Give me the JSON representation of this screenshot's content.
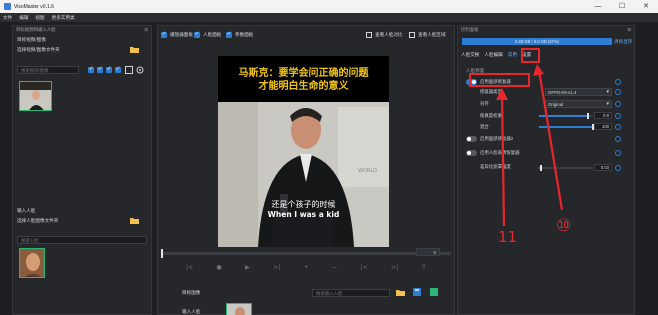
{
  "window": {
    "title": "VisoMaster v0.1.6",
    "controls": [
      "—",
      "☐",
      "✕"
    ]
  },
  "menu": [
    "文件",
    "编辑",
    "视图",
    "更多实用类"
  ],
  "left_panel": {
    "header": "目标视频和输入人脸",
    "target_section": {
      "label": "目标视频/图像",
      "button": "选择视频/图像文件夹"
    },
    "search_placeholder": "搜索视频/图像",
    "input_section": {
      "label": "输入人脸",
      "button": "选择人脸图像文件夹"
    },
    "face_search_placeholder": "搜索人脸"
  },
  "viewer": {
    "options": [
      "播放器面板",
      "人脸面板",
      "参数面板"
    ],
    "right_options": [
      "查看人脸对比",
      "查看人脸区域"
    ],
    "caption_top_1": "马斯克：要学会问正确的问题",
    "caption_top_2": "才能明白生命的意义",
    "caption_bottom_zh": "还是个孩子的时候",
    "caption_bottom_en": "When I was a kid",
    "frame_counter": "0",
    "controls": [
      "|<",
      "●",
      "▶",
      ">|",
      "+",
      "−",
      "|<",
      ">|",
      "⠿"
    ],
    "face_row_label": "目标图像",
    "face_row_label_2": "输入人脸",
    "face_search_placeholder": "搜索输入人脸"
  },
  "right_panel": {
    "header": "控制面板",
    "vram": "3.48 GB / 6.0 GB (57%)",
    "clear_vram": "清除显存",
    "tabs": [
      "人脸交换",
      "人脸编辑",
      "常用",
      "设置"
    ],
    "section": "人脸修复",
    "rows": [
      {
        "label": "启用面部修复器",
        "kind": "toggle",
        "on": true
      },
      {
        "label": "修复器类型",
        "kind": "dropdown",
        "value": "GFPGAN-v1.4"
      },
      {
        "label": "对齐",
        "kind": "dropdown",
        "value": "Original"
      },
      {
        "label": "保真度权重",
        "kind": "slider",
        "value": "0.9",
        "fraction": 0.9
      },
      {
        "label": "混合",
        "kind": "slider",
        "value": "100",
        "fraction": 1.0
      },
      {
        "label": "启用面部修复器2",
        "kind": "toggle",
        "on": false
      },
      {
        "label": "启用人脸表情恢复器",
        "kind": "toggle",
        "on": false
      },
      {
        "label": "差异化遮罩强度",
        "kind": "slider",
        "value": "0.03",
        "fraction": 0.03
      }
    ]
  },
  "annotations": {
    "n11": "11",
    "n10": "⑩"
  },
  "colors": {
    "accent": "#2d7dd2",
    "annotation": "#e8262b",
    "caption_yellow": "#f0c419"
  }
}
